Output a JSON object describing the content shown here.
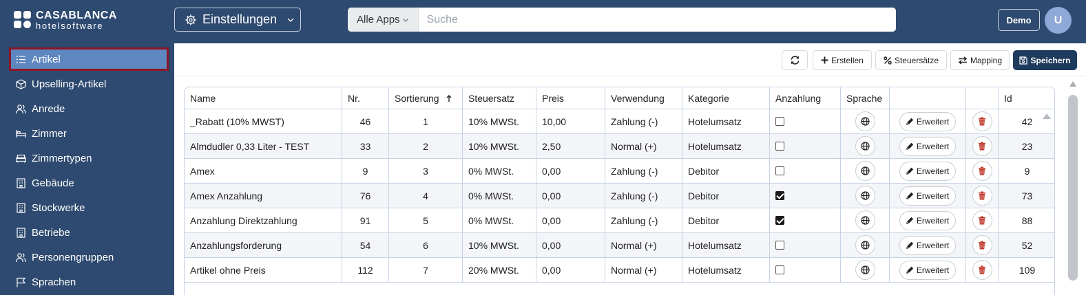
{
  "brand": {
    "title": "CASABLANCA",
    "subtitle": "hotelsoftware"
  },
  "header": {
    "module_label": "Einstellungen",
    "apps_select": "Alle Apps",
    "search_placeholder": "Suche",
    "demo_label": "Demo",
    "avatar_initial": "U"
  },
  "sidebar": {
    "items": [
      {
        "label": "Artikel",
        "icon": "list-icon",
        "active": true
      },
      {
        "label": "Upselling-Artikel",
        "icon": "cube-icon"
      },
      {
        "label": "Anrede",
        "icon": "users-icon"
      },
      {
        "label": "Zimmer",
        "icon": "bed-icon"
      },
      {
        "label": "Zimmertypen",
        "icon": "sofa-icon"
      },
      {
        "label": "Gebäude",
        "icon": "building-icon"
      },
      {
        "label": "Stockwerke",
        "icon": "building-icon"
      },
      {
        "label": "Betriebe",
        "icon": "building-icon"
      },
      {
        "label": "Personengruppen",
        "icon": "users-icon"
      },
      {
        "label": "Sprachen",
        "icon": "flag-icon"
      }
    ]
  },
  "toolbar": {
    "refresh_icon": "refresh-icon",
    "create_label": "Erstellen",
    "tax_label": "Steuersätze",
    "mapping_label": "Mapping",
    "save_label": "Speichern"
  },
  "table": {
    "columns": [
      "Name",
      "Nr.",
      "Sortierung",
      "Steuersatz",
      "Preis",
      "Verwendung",
      "Kategorie",
      "Anzahlung",
      "Sprache",
      "",
      "",
      "Id"
    ],
    "sort_column": "Sortierung",
    "sort_direction": "ascending",
    "action_label": "Erweitert",
    "rows": [
      {
        "name": "_Rabatt (10% MWST)",
        "nr": "46",
        "sort": "1",
        "tax": "10% MWSt.",
        "price": "10,00",
        "usage": "Zahlung (-)",
        "category": "Hotelumsatz",
        "deposit": false,
        "id": "42"
      },
      {
        "name": "Almdudler 0,33 Liter - TEST",
        "nr": "33",
        "sort": "2",
        "tax": "10% MWSt.",
        "price": "2,50",
        "usage": "Normal (+)",
        "category": "Hotelumsatz",
        "deposit": false,
        "id": "23"
      },
      {
        "name": "Amex",
        "nr": "9",
        "sort": "3",
        "tax": "0% MWSt.",
        "price": "0,00",
        "usage": "Zahlung (-)",
        "category": "Debitor",
        "deposit": false,
        "id": "9"
      },
      {
        "name": "Amex Anzahlung",
        "nr": "76",
        "sort": "4",
        "tax": "0% MWSt.",
        "price": "0,00",
        "usage": "Zahlung (-)",
        "category": "Debitor",
        "deposit": true,
        "id": "73"
      },
      {
        "name": "Anzahlung Direktzahlung",
        "nr": "91",
        "sort": "5",
        "tax": "0% MWSt.",
        "price": "0,00",
        "usage": "Zahlung (-)",
        "category": "Debitor",
        "deposit": true,
        "id": "88"
      },
      {
        "name": "Anzahlungsforderung",
        "nr": "54",
        "sort": "6",
        "tax": "10% MWSt.",
        "price": "0,00",
        "usage": "Normal (+)",
        "category": "Hotelumsatz",
        "deposit": false,
        "id": "52"
      },
      {
        "name": "Artikel ohne Preis",
        "nr": "112",
        "sort": "7",
        "tax": "20% MWSt.",
        "price": "0,00",
        "usage": "Normal (+)",
        "category": "Hotelumsatz",
        "deposit": false,
        "id": "109"
      }
    ]
  },
  "colors": {
    "nav_bg": "#2e4a70",
    "active_item": "#5e86bf",
    "active_border": "#8c1424",
    "save_bg": "#1e3a5c"
  }
}
